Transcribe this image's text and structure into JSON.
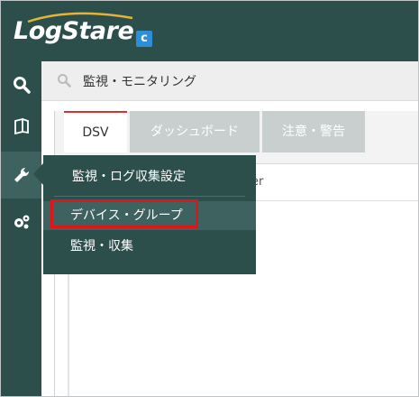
{
  "app": {
    "logo_text": "LogStare",
    "logo_badge": "c"
  },
  "rail": {
    "items": [
      {
        "icon": "search-icon",
        "active": false
      },
      {
        "icon": "book-icon",
        "active": false
      },
      {
        "icon": "wrench-icon",
        "active": true
      },
      {
        "icon": "gears-icon",
        "active": false
      }
    ]
  },
  "search": {
    "icon": "search-icon",
    "text": "監視・モニタリング"
  },
  "tabs": [
    {
      "label": "DSV",
      "active": true
    },
    {
      "label": "ダッシュボード",
      "active": false
    },
    {
      "label": "注意・警告",
      "active": false
    }
  ],
  "panel": {
    "partial_text": "er"
  },
  "flyout": {
    "title": "監視・ログ収集設定",
    "items": [
      {
        "label": "デバイス・グループ",
        "highlighted": true
      },
      {
        "label": "監視・収集",
        "highlighted": false
      }
    ]
  },
  "colors": {
    "primary": "#2d4f4c",
    "highlight": "#e0141b",
    "tab_active_border": "#d9312e"
  }
}
